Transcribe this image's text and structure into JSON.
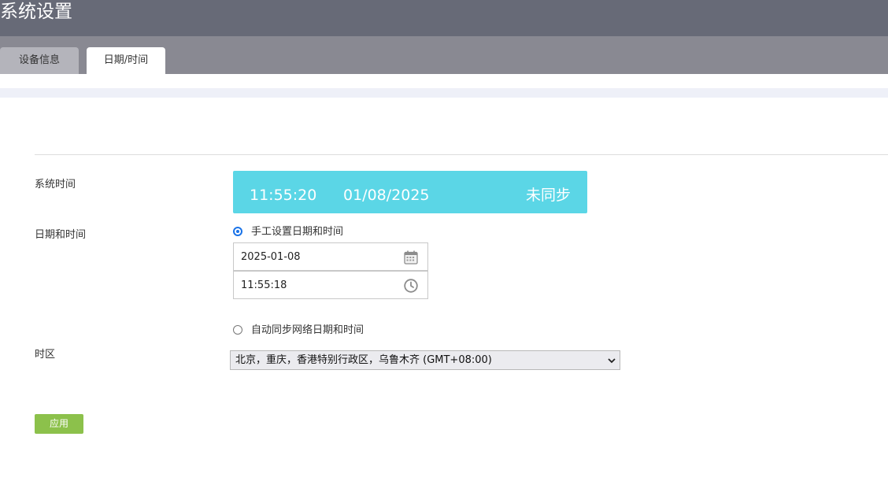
{
  "app": {
    "title": "系统设置"
  },
  "tabs": [
    {
      "label": "设备信息",
      "active": false
    },
    {
      "label": "日期/时间",
      "active": true
    }
  ],
  "system_time": {
    "label": "系统时间",
    "time": "11:55:20",
    "date": "01/08/2025",
    "sync_status": "未同步",
    "color": "#5bd6e6"
  },
  "datetime": {
    "label": "日期和时间",
    "manual_option": {
      "label": "手工设置日期和时间",
      "selected": true
    },
    "date_value": "2025-01-08",
    "time_value": "11:55:18",
    "auto_option": {
      "label": "自动同步网络日期和时间",
      "selected": false
    }
  },
  "timezone": {
    "label": "时区",
    "selected": "北京，重庆，香港特别行政区，乌鲁木齐 (GMT+08:00)"
  },
  "apply_button": {
    "label": "应用",
    "color": "#8cc14b"
  },
  "icons": [
    "calendar-icon",
    "clock-icon",
    "chevron-down-icon"
  ],
  "colors": {
    "header": "#676a77",
    "tabbar": "#898992",
    "radio_active": "#1a73e8"
  }
}
